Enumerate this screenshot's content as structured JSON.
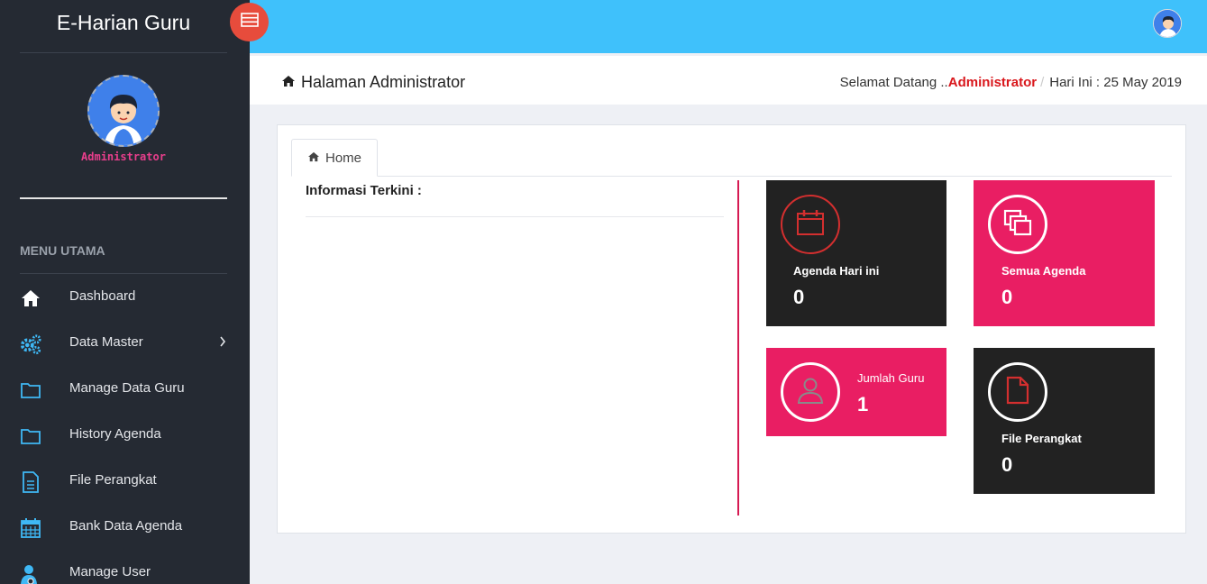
{
  "app": {
    "title": "E-Harian Guru"
  },
  "profile": {
    "name": "Administrator"
  },
  "menu": {
    "title": "MENU UTAMA",
    "items": [
      {
        "label": "Dashboard",
        "icon": "home-icon"
      },
      {
        "label": "Data Master",
        "icon": "gears-icon",
        "chevron": "›"
      },
      {
        "label": "Manage Data Guru",
        "icon": "folder-icon"
      },
      {
        "label": "History Agenda",
        "icon": "folder-icon"
      },
      {
        "label": "File Perangkat",
        "icon": "file-text-icon"
      },
      {
        "label": "Bank Data Agenda",
        "icon": "calendar-icon"
      },
      {
        "label": "Manage User",
        "icon": "user-cog-icon"
      }
    ]
  },
  "header": {
    "page_title": "Halaman Administrator",
    "welcome": "Selamat Datang ..",
    "user": "Administrator",
    "sep": "/",
    "date_label": "Hari Ini : 25 May 2019"
  },
  "tabs": [
    {
      "label": "Home"
    }
  ],
  "info": {
    "title": "Informasi Terkini :"
  },
  "tiles": {
    "agenda_today": {
      "label": "Agenda Hari ini",
      "value": "0"
    },
    "all_agenda": {
      "label": "Semua Agenda",
      "value": "0"
    },
    "teachers": {
      "label": "Jumlah Guru",
      "value": "1"
    },
    "files": {
      "label": "File Perangkat",
      "value": "0"
    }
  },
  "colors": {
    "topbar": "#3fc1fb",
    "sidebar": "#252a33",
    "accent_red": "#e74c3c",
    "tile_pink": "#e91e63",
    "tile_dark": "#222222",
    "admin_text": "#d9171c",
    "menu_icon": "#3fb8f5"
  }
}
